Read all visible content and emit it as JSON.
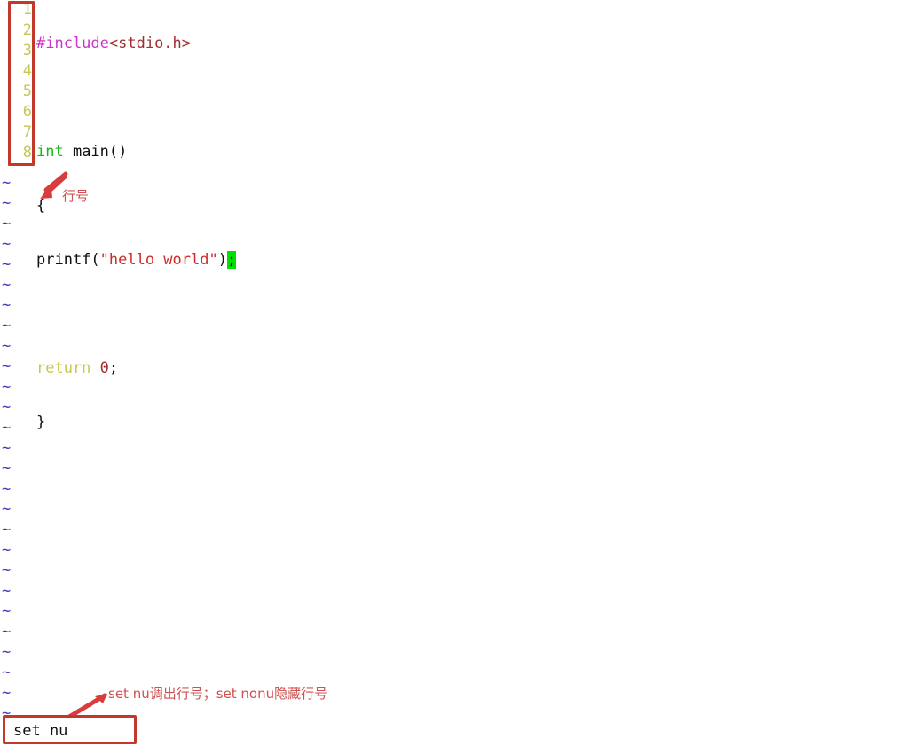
{
  "editor": {
    "mode": "vim",
    "background_color": "#ffffff",
    "gutter": {
      "line_numbers": [
        "1",
        "2",
        "3",
        "4",
        "5",
        "6",
        "7",
        "8"
      ],
      "number_color": "#c8c850",
      "highlight_box_color": "#c0392b"
    },
    "code_lines": [
      {
        "number": "1",
        "tokens": [
          {
            "text": "#include",
            "kind": "preproc"
          },
          {
            "text": "<stdio.h>",
            "kind": "header"
          }
        ]
      },
      {
        "number": "2",
        "tokens": [
          {
            "text": "",
            "kind": "plain"
          }
        ]
      },
      {
        "number": "3",
        "tokens": [
          {
            "text": "int",
            "kind": "type"
          },
          {
            "text": " main()",
            "kind": "plain"
          }
        ]
      },
      {
        "number": "4",
        "tokens": [
          {
            "text": "{",
            "kind": "plain"
          }
        ]
      },
      {
        "number": "5",
        "tokens": [
          {
            "text": "printf(",
            "kind": "plain"
          },
          {
            "text": "\"hello world\"",
            "kind": "string"
          },
          {
            "text": ")",
            "kind": "plain"
          },
          {
            "text": ";",
            "kind": "cursor"
          }
        ]
      },
      {
        "number": "6",
        "tokens": [
          {
            "text": "",
            "kind": "plain"
          }
        ]
      },
      {
        "number": "7",
        "tokens": [
          {
            "text": "return",
            "kind": "keyword"
          },
          {
            "text": " ",
            "kind": "plain"
          },
          {
            "text": "0",
            "kind": "number"
          },
          {
            "text": ";",
            "kind": "plain"
          }
        ]
      },
      {
        "number": "8",
        "tokens": [
          {
            "text": "}",
            "kind": "plain"
          }
        ]
      }
    ],
    "empty_line_marker": "~",
    "empty_line_marker_color": "#3b3bbf",
    "empty_line_count": 27
  },
  "annotations": {
    "gutter_label": "行号",
    "command_label": "set nu调出行号；set nonu隐藏行号",
    "color": "#d05050",
    "arrow_color": "#d83c3c"
  },
  "command_line": {
    "value": "set nu",
    "placeholder": "",
    "border_color": "#c0392b",
    "text_color": "#101010"
  }
}
